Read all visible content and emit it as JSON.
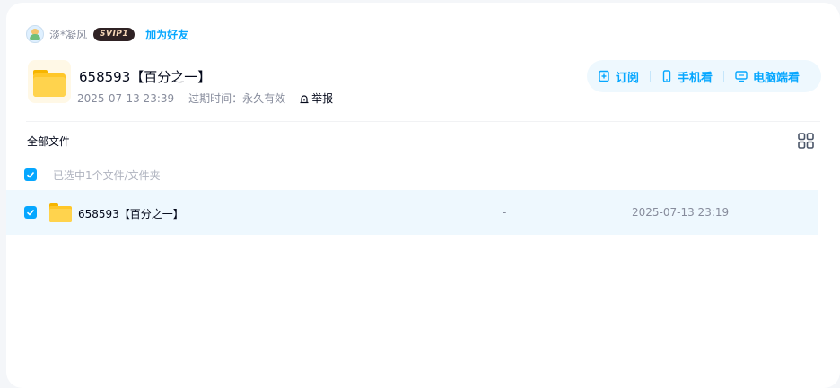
{
  "user": {
    "name": "淡*凝风",
    "badge": "SVIP1",
    "add_friend": "加为好友"
  },
  "share": {
    "title": "658593【百分之一】",
    "created": "2025-07-13 23:39",
    "expiry_label": "过期时间：",
    "expiry_value": "永久有效",
    "report": "举报"
  },
  "actions": {
    "subscribe": "订阅",
    "mobile": "手机看",
    "desktop": "电脑端看"
  },
  "breadcrumb": "全部文件",
  "selection_text": "已选中1个文件/文件夹",
  "files": [
    {
      "name": "658593【百分之一】",
      "size": "-",
      "modified": "2025-07-13 23:19",
      "selected": true
    }
  ],
  "colors": {
    "accent": "#06a7ff",
    "selected_row_bg": "#eef8fe",
    "folder": "#ffc729"
  }
}
